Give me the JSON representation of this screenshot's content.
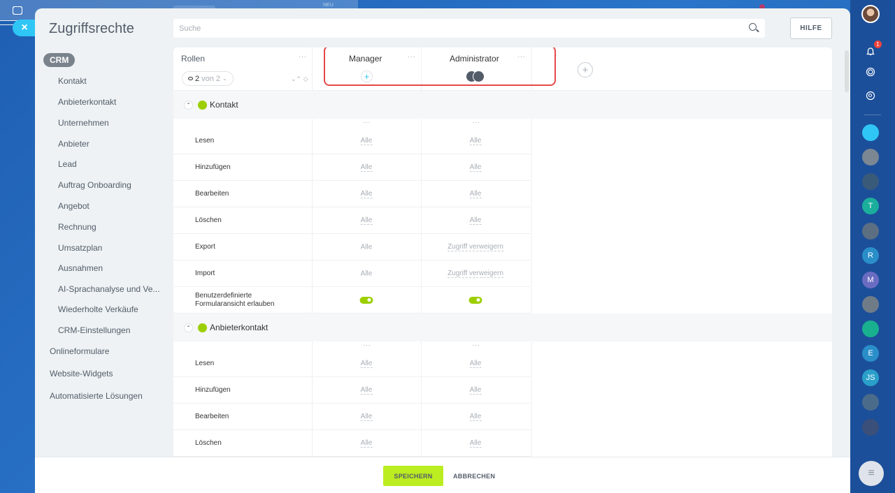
{
  "panel": {
    "title": "Zugriffsrechte",
    "search_placeholder": "Suche",
    "help_label": "HILFE"
  },
  "nav": {
    "crm_label": "CRM",
    "items": [
      "Kontakt",
      "Anbieterkontakt",
      "Unternehmen",
      "Anbieter",
      "Lead",
      "Auftrag Onboarding",
      "Angebot",
      "Rechnung",
      "Umsatzplan",
      "Ausnahmen",
      "AI-Sprachanalyse und Ve...",
      "Wiederholte Verkäufe",
      "CRM-Einstellungen"
    ],
    "top_items": [
      "Onlineformulare",
      "Website-Widgets",
      "Automatisierte Lösungen"
    ]
  },
  "table": {
    "roles_header": "Rollen",
    "role_count_current": "2",
    "role_count_rest": "von 2",
    "roles": [
      "Manager",
      "Administrator"
    ],
    "sections": [
      {
        "name": "Kontakt",
        "rows": [
          {
            "label": "Lesen",
            "manager": "Alle",
            "admin": "Alle"
          },
          {
            "label": "Hinzufügen",
            "manager": "Alle",
            "admin": "Alle"
          },
          {
            "label": "Bearbeiten",
            "manager": "Alle",
            "admin": "Alle"
          },
          {
            "label": "Löschen",
            "manager": "Alle",
            "admin": "Alle"
          },
          {
            "label": "Export",
            "manager": "Alle",
            "admin": "Zugriff verweigern"
          },
          {
            "label": "Import",
            "manager": "Alle",
            "admin": "Zugriff verweigern"
          },
          {
            "label": "Benutzerdefinierte Formularansicht erlauben",
            "manager": "toggle-on",
            "admin": "toggle-on"
          }
        ]
      },
      {
        "name": "Anbieterkontakt",
        "rows": [
          {
            "label": "Lesen",
            "manager": "Alle",
            "admin": "Alle"
          },
          {
            "label": "Hinzufügen",
            "manager": "Alle",
            "admin": "Alle"
          },
          {
            "label": "Bearbeiten",
            "manager": "Alle",
            "admin": "Alle"
          },
          {
            "label": "Löschen",
            "manager": "Alle",
            "admin": "Alle"
          }
        ]
      }
    ]
  },
  "footer": {
    "save_label": "SPEICHERN",
    "cancel_label": "ABBRECHEN"
  },
  "background": {
    "neu_label": "NEU",
    "notifications_badge": "1"
  },
  "colors": {
    "accent_green": "#bbed21",
    "toggle_green": "#9dcf00",
    "highlight_red": "#e5494a",
    "close_blue": "#2fc6f6"
  }
}
